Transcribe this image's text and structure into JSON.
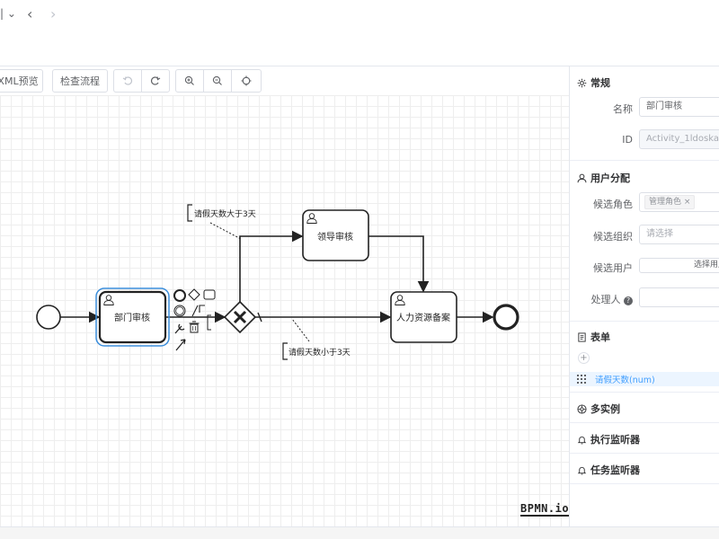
{
  "topbar": {
    "tab_tail": "|",
    "tab_caret": "⌄",
    "back": "‹",
    "forward": "›"
  },
  "toolbar": {
    "xml_preview": "XML预览",
    "check_flow": "检查流程"
  },
  "diagram": {
    "tasks": {
      "dept_review": "部门审核",
      "leader_review": "领导审核",
      "hr_record": "人力资源备案"
    },
    "annotations": {
      "gt3": "请假天数大于3天",
      "lt3": "请假天数小于3天"
    },
    "logo": "BPMN.io"
  },
  "panel": {
    "general": {
      "title": "常规",
      "name_label": "名称",
      "name_value": "部门审核",
      "id_label": "ID",
      "id_value": "Activity_1ldoska"
    },
    "assignment": {
      "title": "用户分配",
      "role_label": "候选角色",
      "role_tag": "管理角色",
      "role_tag_close": "×",
      "org_label": "候选组织",
      "org_placeholder": "请选择",
      "user_label": "候选用户",
      "user_button": "选择用户",
      "handler_label": "处理人",
      "help": "?"
    },
    "form": {
      "title": "表单",
      "add": "+",
      "field": "请假天数(num)"
    },
    "multi": {
      "title": "多实例"
    },
    "exec_listener": {
      "title": "执行监听器"
    },
    "task_listener": {
      "title": "任务监听器"
    }
  }
}
